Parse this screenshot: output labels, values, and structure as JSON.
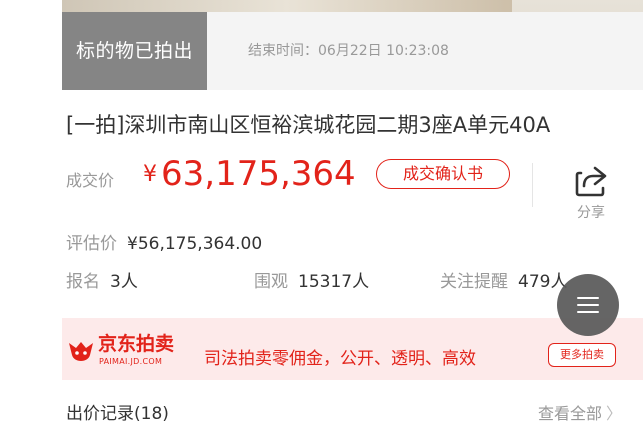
{
  "header": {
    "status_tag": "标的物已拍出",
    "end_time": "结束时间：06月22日 10:23:08"
  },
  "item": {
    "title": "[一拍]深圳市南山区恒裕滨城花园二期3座A单元40A"
  },
  "price": {
    "label": "成交价",
    "currency": "¥",
    "value": "63,175,364",
    "confirm_button": "成交确认书"
  },
  "share": {
    "icon": "share-icon",
    "label": "分享"
  },
  "appraisal": {
    "label": "评估价",
    "value": "¥56,175,364.00"
  },
  "stats": {
    "signup_label": "报名",
    "signup_value": "3人",
    "views_label": "围观",
    "views_value": "15317人",
    "reminder_label": "关注提醒",
    "reminder_value": "479人"
  },
  "banner": {
    "brand_cn": "京东拍卖",
    "brand_en": "PAIMAI.JD.COM",
    "slogan": "司法拍卖零佣金，公开、透明、高效",
    "more_button": "更多拍卖"
  },
  "bids": {
    "label": "出价记录(18)",
    "view_all": "查看全部"
  },
  "colors": {
    "accent": "#e2231a",
    "status_bg": "#858585",
    "muted": "#999999",
    "banner_bg": "#fdeaea"
  }
}
